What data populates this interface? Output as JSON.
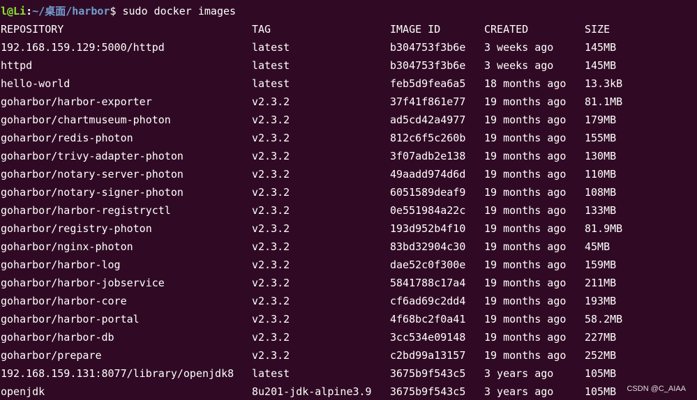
{
  "prompt": {
    "user_host": "l@Li",
    "separator": ":",
    "path": "~/桌面/harbor",
    "symbol": "$",
    "command": " sudo docker images"
  },
  "table": {
    "headers": [
      "REPOSITORY",
      "TAG",
      "IMAGE ID",
      "CREATED",
      "SIZE"
    ],
    "rows": [
      [
        "192.168.159.129:5000/httpd",
        "latest",
        "b304753f3b6e",
        "3 weeks ago",
        "145MB"
      ],
      [
        "httpd",
        "latest",
        "b304753f3b6e",
        "3 weeks ago",
        "145MB"
      ],
      [
        "hello-world",
        "latest",
        "feb5d9fea6a5",
        "18 months ago",
        "13.3kB"
      ],
      [
        "goharbor/harbor-exporter",
        "v2.3.2",
        "37f41f861e77",
        "19 months ago",
        "81.1MB"
      ],
      [
        "goharbor/chartmuseum-photon",
        "v2.3.2",
        "ad5cd42a4977",
        "19 months ago",
        "179MB"
      ],
      [
        "goharbor/redis-photon",
        "v2.3.2",
        "812c6f5c260b",
        "19 months ago",
        "155MB"
      ],
      [
        "goharbor/trivy-adapter-photon",
        "v2.3.2",
        "3f07adb2e138",
        "19 months ago",
        "130MB"
      ],
      [
        "goharbor/notary-server-photon",
        "v2.3.2",
        "49aadd974d6d",
        "19 months ago",
        "110MB"
      ],
      [
        "goharbor/notary-signer-photon",
        "v2.3.2",
        "6051589deaf9",
        "19 months ago",
        "108MB"
      ],
      [
        "goharbor/harbor-registryctl",
        "v2.3.2",
        "0e551984a22c",
        "19 months ago",
        "133MB"
      ],
      [
        "goharbor/registry-photon",
        "v2.3.2",
        "193d952b4f10",
        "19 months ago",
        "81.9MB"
      ],
      [
        "goharbor/nginx-photon",
        "v2.3.2",
        "83bd32904c30",
        "19 months ago",
        "45MB"
      ],
      [
        "goharbor/harbor-log",
        "v2.3.2",
        "dae52c0f300e",
        "19 months ago",
        "159MB"
      ],
      [
        "goharbor/harbor-jobservice",
        "v2.3.2",
        "5841788c17a4",
        "19 months ago",
        "211MB"
      ],
      [
        "goharbor/harbor-core",
        "v2.3.2",
        "cf6ad69c2dd4",
        "19 months ago",
        "193MB"
      ],
      [
        "goharbor/harbor-portal",
        "v2.3.2",
        "4f68bc2f0a41",
        "19 months ago",
        "58.2MB"
      ],
      [
        "goharbor/harbor-db",
        "v2.3.2",
        "3cc534e09148",
        "19 months ago",
        "227MB"
      ],
      [
        "goharbor/prepare",
        "v2.3.2",
        "c2bd99a13157",
        "19 months ago",
        "252MB"
      ],
      [
        "192.168.159.131:8077/library/openjdk8",
        "latest",
        "3675b9f543c5",
        "3 years ago",
        "105MB"
      ],
      [
        "openjdk",
        "8u201-jdk-alpine3.9",
        "3675b9f543c5",
        "3 years ago",
        "105MB"
      ]
    ]
  },
  "watermark": "CSDN @C_AIAA",
  "colors": {
    "background": "#300a24",
    "prompt_user": "#8ae234",
    "prompt_path": "#729fcf",
    "text": "#ffffff"
  }
}
